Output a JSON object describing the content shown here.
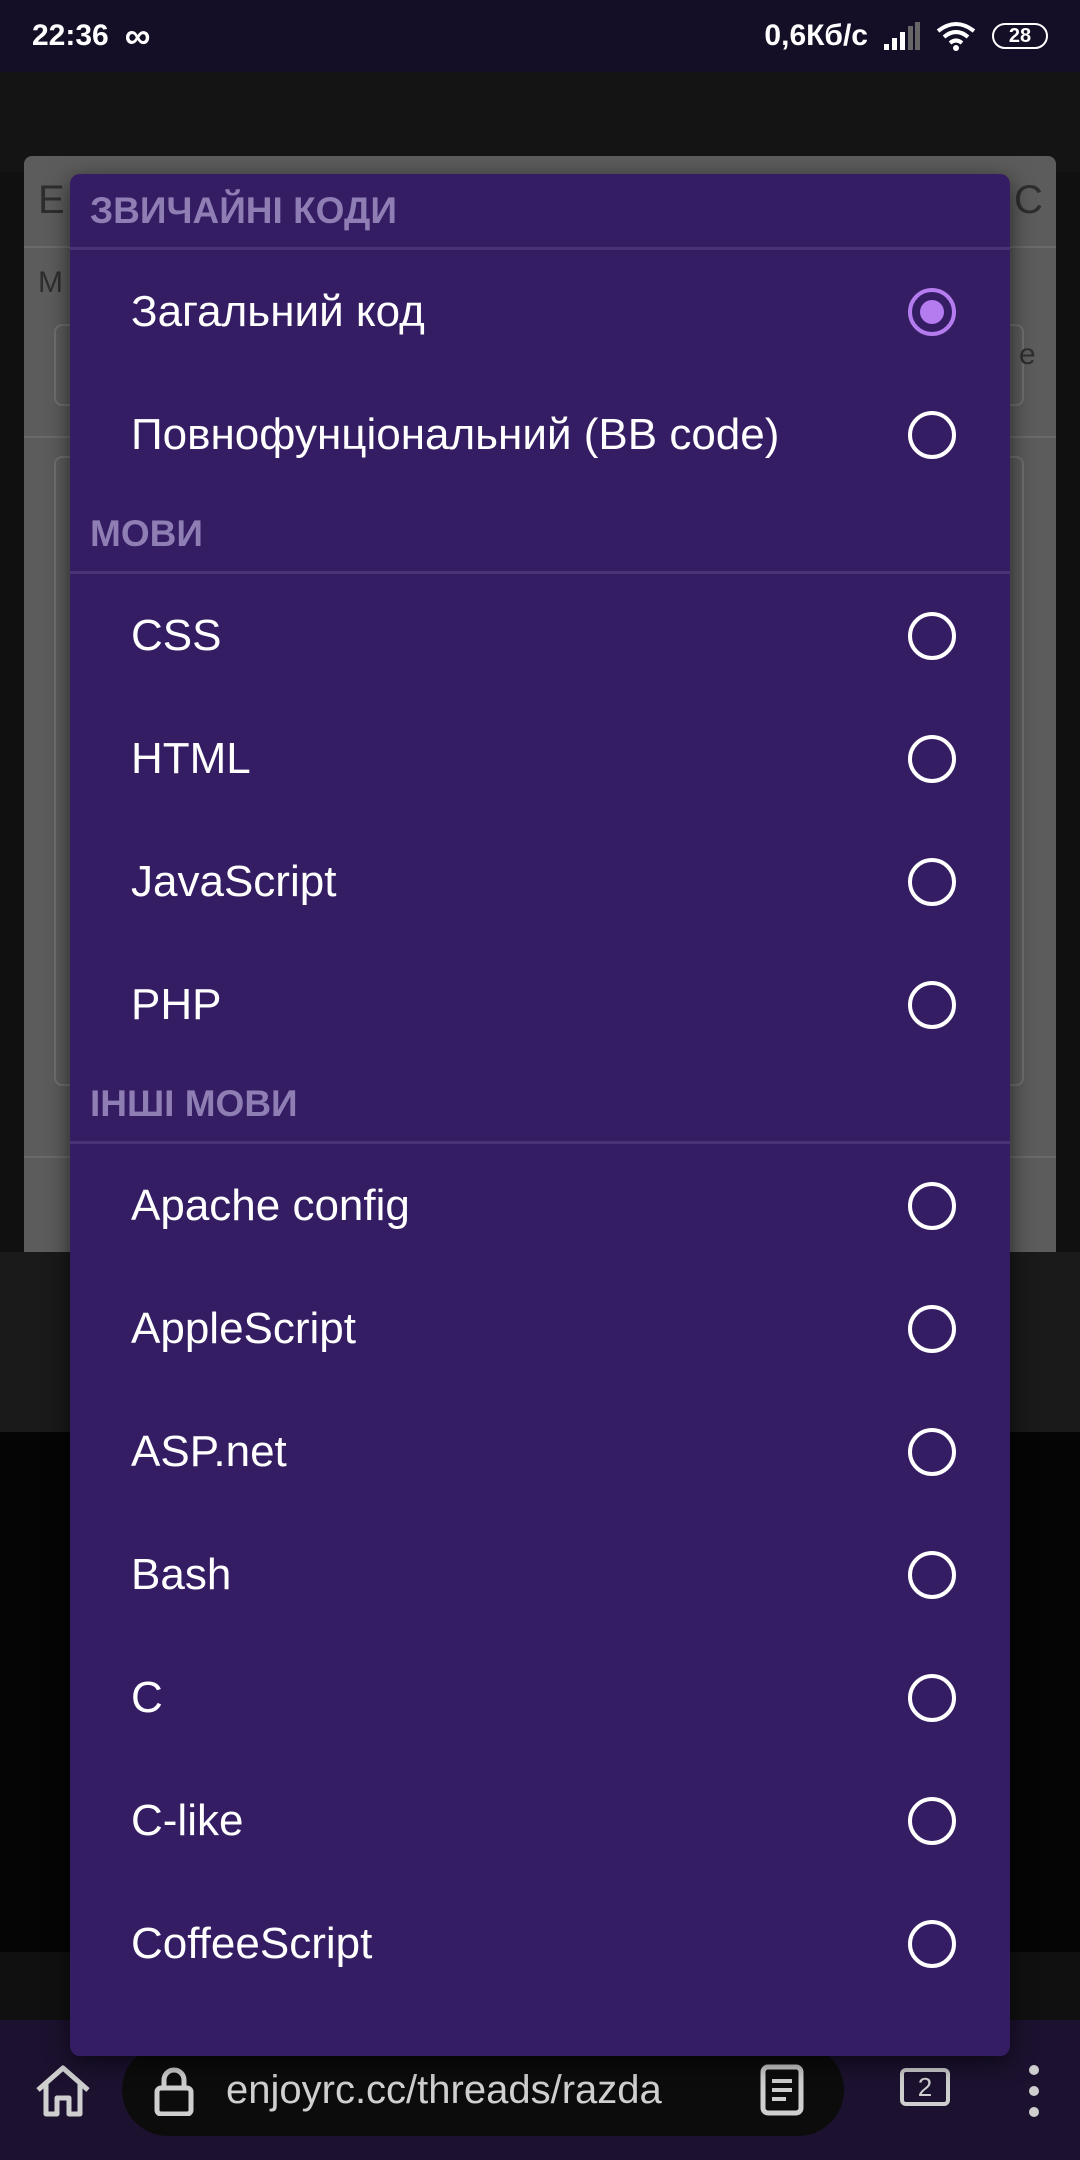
{
  "status_bar": {
    "time": "22:36",
    "infinity": "∞",
    "net_speed": "0,6Кб/с",
    "battery": "28"
  },
  "background_page": {
    "title_fragment": "E",
    "label_fragment": "M",
    "close_fragment": "C",
    "chevron_fragment": "e"
  },
  "dialog": {
    "sections": [
      {
        "title": "ЗВИЧАЙНІ КОДИ",
        "options": [
          {
            "label": "Загальний код",
            "selected": true
          },
          {
            "label": "Повнофунціональний (BB code)",
            "selected": false
          }
        ]
      },
      {
        "title": "МОВИ",
        "options": [
          {
            "label": "CSS",
            "selected": false
          },
          {
            "label": "HTML",
            "selected": false
          },
          {
            "label": "JavaScript",
            "selected": false
          },
          {
            "label": "PHP",
            "selected": false
          }
        ]
      },
      {
        "title": "ІНШІ МОВИ",
        "options": [
          {
            "label": "Apache config",
            "selected": false
          },
          {
            "label": "AppleScript",
            "selected": false
          },
          {
            "label": "ASP.net",
            "selected": false
          },
          {
            "label": "Bash",
            "selected": false
          },
          {
            "label": "C",
            "selected": false
          },
          {
            "label": "C-like",
            "selected": false
          },
          {
            "label": "CoffeeScript",
            "selected": false
          }
        ]
      }
    ]
  },
  "browser_bar": {
    "url": "enjoyrc.cc/threads/razda",
    "tab_count": "2",
    "icons": [
      "home-icon",
      "lock-icon",
      "reader-icon",
      "tabs-icon",
      "more-icon"
    ]
  },
  "colors": {
    "dialog_bg": "#341d63",
    "section_header_text": "#8f7eb4",
    "radio_selected": "#b57cf0",
    "status_bar_bg": "#140e26",
    "browser_bar_bg": "#1c1230"
  }
}
